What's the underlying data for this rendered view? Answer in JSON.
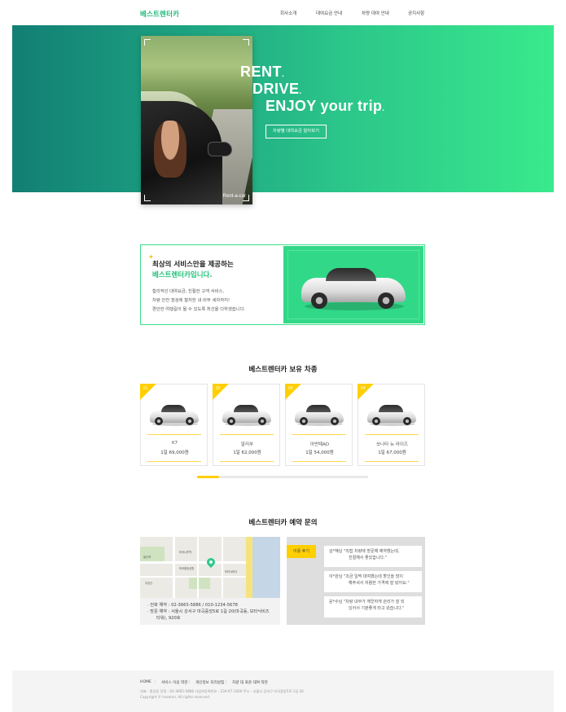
{
  "header": {
    "logo": "베스트렌터카",
    "nav": [
      "회사소개",
      "대여요금 안내",
      "차량 대여 안내",
      "공지사항"
    ]
  },
  "hero": {
    "line1": "RENT",
    "line2": "DRIVE",
    "line3": "ENJOY your trip",
    "button": "차량별 대여요금 알아보기",
    "photo_tag": "Rent-a-car"
  },
  "intro": {
    "title1": "최상의 서비스만을 제공하는",
    "title2": "베스트렌터카입니다.",
    "lines": [
      "합리적인 대여요금, 친절한 고객 서비스,",
      "차량 안전 점검에 철저한 내·외부 세차까지!",
      "편안한 여행길이 될 수 있도록 최선을 다하겠습니다."
    ]
  },
  "fleet": {
    "title": "베스트렌터카 보유 차종",
    "cars": [
      {
        "num": "01",
        "name": "K7",
        "price": "1일 69,000원"
      },
      {
        "num": "02",
        "name": "말리부",
        "price": "1일 62,000원"
      },
      {
        "num": "03",
        "name": "아반떼AD",
        "price": "1일 54,000원"
      },
      {
        "num": "04",
        "name": "쏘나타 뉴 라이즈",
        "price": "1일 67,000원"
      }
    ],
    "scroll_progress": 0.13
  },
  "reservation": {
    "title": "베스트렌터카 예약 문의",
    "phone": "· 전화 예약 : 02-3665-5886 / 010-1234-5678",
    "visit1": "· 방문 예약 : 서울시 강서구 마곡중앙5로 1길 20(마곡동, 보타닉비즈",
    "visit2": "타워), 920호",
    "review_tag": "이용 후기",
    "reviews": [
      {
        "l1": "김*혜님  \"직접 차량에 방문해 예약했는데,",
        "l2": "친절해서 좋았습니다.\""
      },
      {
        "l1": "이*원님  \"조금 일찍 대여했는데 할인을 많이",
        "l2": "해주셔서 저렴한 가격에 잘 탔어요.\""
      },
      {
        "l1": "윤*수님  \"차량 내부가 깨끗하게 관리가 잘 되",
        "l2": "있어서 기분좋게 타고 왔습니다.\""
      }
    ],
    "map_labels": [
      "발산역",
      "마곡나루역",
      "마곡중앙공원",
      "우장산",
      "보타닉파크"
    ]
  },
  "footer": {
    "links": [
      "HOME",
      "서비스 이용 약관",
      "개인정보 처리방침",
      "차량 대 표준 대여 약관"
    ],
    "info": "대표 : 홍길동    전화 : 02-3665-5886    사업자등록번호 : 234-67-1000    주소 : 서울시 강서구 마곡중앙5로 1길 20",
    "copyright": "Copyright © hosemo. All rights reserved."
  },
  "colors": {
    "brand": "#22b87a",
    "accent": "#ffcf00",
    "hero_start": "#127f74",
    "hero_end": "#39ea8c"
  }
}
